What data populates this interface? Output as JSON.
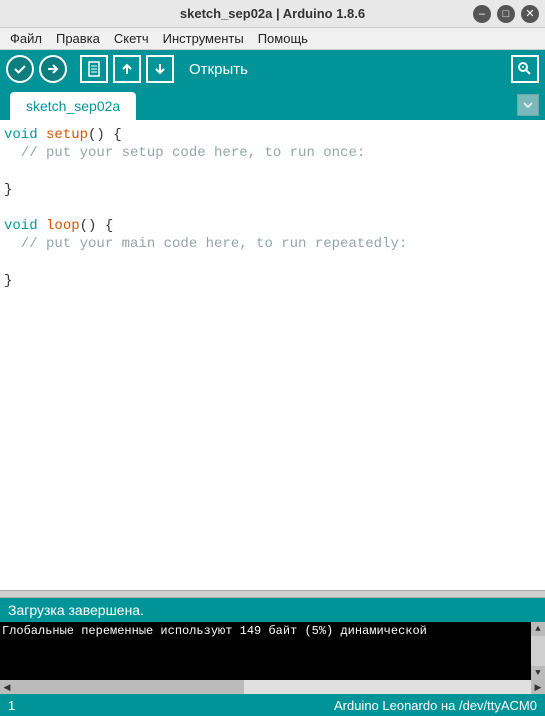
{
  "titlebar": {
    "title": "sketch_sep02a | Arduino 1.8.6"
  },
  "menubar": {
    "items": [
      "Файл",
      "Правка",
      "Скетч",
      "Инструменты",
      "Помощь"
    ]
  },
  "toolbar": {
    "action_label": "Открыть"
  },
  "tab": {
    "name": "sketch_sep02a"
  },
  "code": {
    "lines": [
      {
        "type": "code",
        "parts": [
          {
            "t": "kw-type",
            "v": "void"
          },
          {
            "t": "",
            "v": " "
          },
          {
            "t": "kw-func",
            "v": "setup"
          },
          {
            "t": "",
            "v": "() {"
          }
        ]
      },
      {
        "type": "comment",
        "v": "  // put your setup code here, to run once:"
      },
      {
        "type": "blank"
      },
      {
        "type": "plain",
        "v": "}"
      },
      {
        "type": "blank"
      },
      {
        "type": "code",
        "parts": [
          {
            "t": "kw-type",
            "v": "void"
          },
          {
            "t": "",
            "v": " "
          },
          {
            "t": "kw-func",
            "v": "loop"
          },
          {
            "t": "",
            "v": "() {"
          }
        ]
      },
      {
        "type": "comment",
        "v": "  // put your main code here, to run repeatedly:"
      },
      {
        "type": "blank"
      },
      {
        "type": "plain",
        "v": "}"
      }
    ]
  },
  "status": {
    "message": "Загрузка завершена."
  },
  "console": {
    "line1": "Глобальные переменные используют 149 байт (5%) динамической"
  },
  "bottombar": {
    "line_number": "1",
    "board_info": "Arduino Leonardo на /dev/ttyACM0"
  }
}
